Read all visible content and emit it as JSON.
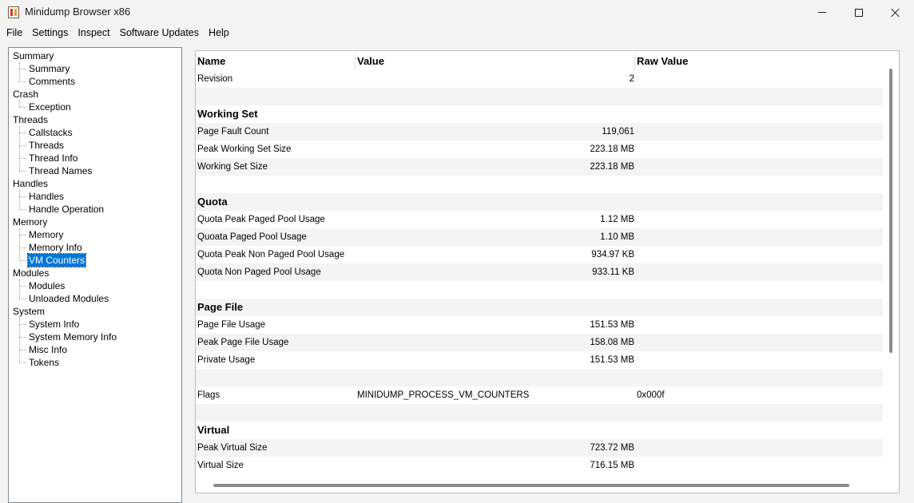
{
  "window": {
    "title": "Minidump Browser x86"
  },
  "menu": [
    "File",
    "Settings",
    "Inspect",
    "Software Updates",
    "Help"
  ],
  "tree": [
    {
      "label": "Summary",
      "children": [
        "Summary",
        "Comments"
      ]
    },
    {
      "label": "Crash",
      "children": [
        "Exception"
      ]
    },
    {
      "label": "Threads",
      "children": [
        "Callstacks",
        "Threads",
        "Thread Info",
        "Thread Names"
      ]
    },
    {
      "label": "Handles",
      "children": [
        "Handles",
        "Handle Operation"
      ]
    },
    {
      "label": "Memory",
      "children": [
        "Memory",
        "Memory Info",
        "VM Counters"
      ]
    },
    {
      "label": "Modules",
      "children": [
        "Modules",
        "Unloaded Modules"
      ]
    },
    {
      "label": "System",
      "children": [
        "System Info",
        "System Memory Info",
        "Misc Info",
        "Tokens"
      ]
    }
  ],
  "selected_tree_item": "VM Counters",
  "table": {
    "columns": [
      "Name",
      "Value",
      "Raw Value"
    ],
    "rows": [
      {
        "name": "Revision",
        "value": "2",
        "raw": ""
      },
      {
        "name": "",
        "value": "",
        "raw": ""
      },
      {
        "name": "Working Set",
        "section": true
      },
      {
        "name": "Page Fault Count",
        "value": "119,061",
        "raw": ""
      },
      {
        "name": "Peak Working Set Size",
        "value": "223.18 MB",
        "raw": ""
      },
      {
        "name": "Working Set Size",
        "value": "223.18 MB",
        "raw": ""
      },
      {
        "name": "",
        "value": "",
        "raw": ""
      },
      {
        "name": "Quota",
        "section": true
      },
      {
        "name": "Quota Peak Paged Pool Usage",
        "value": "1.12 MB",
        "raw": ""
      },
      {
        "name": "Quoata Paged Pool Usage",
        "value": "1.10 MB",
        "raw": ""
      },
      {
        "name": "Quota Peak Non Paged Pool Usage",
        "value": "934.97 KB",
        "raw": ""
      },
      {
        "name": "Quota Non Paged Pool Usage",
        "value": "933.11 KB",
        "raw": ""
      },
      {
        "name": "",
        "value": "",
        "raw": ""
      },
      {
        "name": "Page File",
        "section": true
      },
      {
        "name": "Page File Usage",
        "value": "151.53 MB",
        "raw": ""
      },
      {
        "name": "Peak Page File Usage",
        "value": "158.08 MB",
        "raw": ""
      },
      {
        "name": "Private Usage",
        "value": "151.53 MB",
        "raw": ""
      },
      {
        "name": "",
        "value": "",
        "raw": ""
      },
      {
        "name": "Flags",
        "value": "MINIDUMP_PROCESS_VM_COUNTERS",
        "raw": "0x000f",
        "text_value": true
      },
      {
        "name": "",
        "value": "",
        "raw": ""
      },
      {
        "name": "Virtual",
        "section": true
      },
      {
        "name": "Peak Virtual Size",
        "value": "723.72 MB",
        "raw": ""
      },
      {
        "name": "Virtual Size",
        "value": "716.15 MB",
        "raw": ""
      }
    ]
  }
}
